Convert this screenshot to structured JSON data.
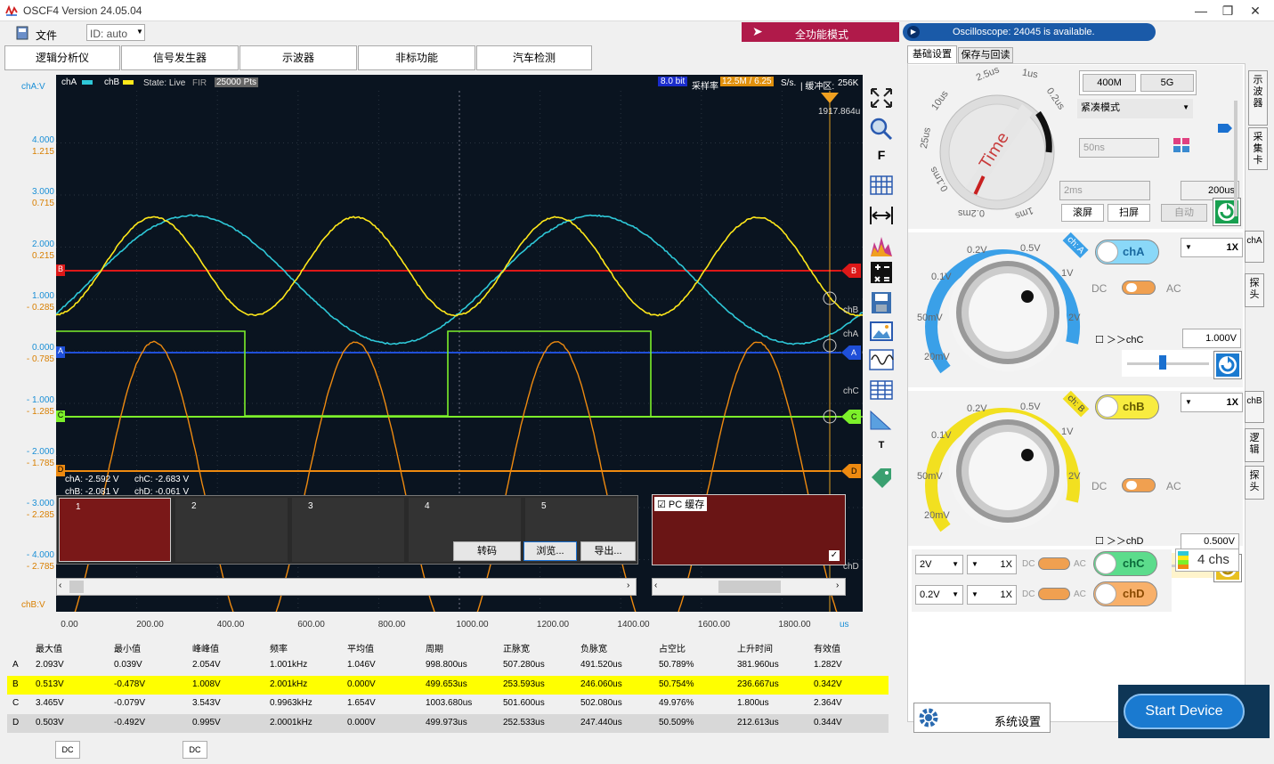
{
  "window": {
    "title": "OSCF4  Version 24.05.04",
    "min": "—",
    "max": "❐",
    "close": "✕",
    "logo_icon": "osc-logo-icon"
  },
  "menubar": {
    "file": "文件",
    "id_label": "ID: auto",
    "fullmode": "全功能模式",
    "notice": "Oscilloscope: 24045 is available."
  },
  "nav_tabs": [
    "逻辑分析仪",
    "信号发生器",
    "示波器",
    "非标功能",
    "汽车检测"
  ],
  "scope": {
    "chA_v_label": "chA:V",
    "chB_v_label": "chB:V",
    "legend": {
      "chA": "chA",
      "chB": "chB",
      "state": "State: Live",
      "fir": "FIR",
      "pts": "25000 Pts",
      "bits": "8.0 bit",
      "rate_label": "采样率",
      "rate": "12.5M / 6.25",
      "rate_unit": "S/s.",
      "buffer": "| 缓冲区:",
      "buffer_size": "256K"
    },
    "cursor_readout": "1917.864u",
    "y_blue": [
      "4.000",
      "3.000",
      "2.000",
      "1.000",
      "0.000",
      "- 1.000",
      "- 2.000",
      "- 3.000",
      "- 4.000"
    ],
    "y_orange": [
      "1.215",
      "0.715",
      "0.215",
      "- 0.285",
      "- 0.785",
      "- 1.285",
      "- 1.785",
      "- 2.285",
      "- 2.785"
    ],
    "x_ticks": [
      "0.00",
      "200.00",
      "400.00",
      "600.00",
      "800.00",
      "1000.00",
      "1200.00",
      "1400.00",
      "1600.00",
      "1800.00"
    ],
    "x_unit": "us",
    "markers": {
      "A": "A",
      "B": "B",
      "C": "C",
      "D": "D"
    },
    "right_labels": {
      "chB": "chB",
      "chA": "chA",
      "chC": "chC",
      "chD": "chD"
    },
    "probe_readout": {
      "a": "chA: -2.592 V",
      "c": "chC: -2.683 V",
      "b": "chB: -2.081 V",
      "d": "chD: -0.061 V"
    },
    "thumbs": [
      "1",
      "2",
      "3",
      "4",
      "5"
    ],
    "thumb_buttons": {
      "convert": "转码",
      "browse": "浏览...",
      "export": "导出..."
    },
    "pc_cache": "PC 缓存",
    "colors": {
      "chA": "#2ec8d8",
      "chB": "#ffe81a",
      "chC": "#7cf02a",
      "chD": "#ee8a10",
      "markB": "#dd1818",
      "markA": "#1f4fd8"
    }
  },
  "tools": [
    "fit-screen-icon",
    "zoom-icon",
    "F",
    "grid-icon",
    "measure-width-icon",
    "spectrum-icon",
    "calc-icon",
    "save-icon",
    "image-icon",
    "waveform-icon",
    "table-icon",
    "ruler-icon",
    "T",
    "tag-icon"
  ],
  "measurements": {
    "headers": [
      "最大值",
      "最小值",
      "峰峰值",
      "频率",
      "平均值",
      "周期",
      "正脉宽",
      "负脉宽",
      "占空比",
      "上升时间",
      "有效值"
    ],
    "rows": [
      {
        "ch": "A",
        "vals": [
          "2.093V",
          "0.039V",
          "2.054V",
          "1.001kHz",
          "1.046V",
          "998.800us",
          "507.280us",
          "491.520us",
          "50.789%",
          "381.960us",
          "1.282V"
        ]
      },
      {
        "ch": "B",
        "vals": [
          "0.513V",
          "-0.478V",
          "1.008V",
          "2.001kHz",
          "0.000V",
          "499.653us",
          "253.593us",
          "246.060us",
          "50.754%",
          "236.667us",
          "0.342V"
        ]
      },
      {
        "ch": "C",
        "vals": [
          "3.465V",
          "-0.079V",
          "3.543V",
          "0.9963kHz",
          "1.654V",
          "1003.680us",
          "501.600us",
          "502.080us",
          "49.976%",
          "1.800us",
          "2.364V"
        ]
      },
      {
        "ch": "D",
        "vals": [
          "0.503V",
          "-0.492V",
          "0.995V",
          "2.0001kHz",
          "0.000V",
          "499.973us",
          "252.533us",
          "247.440us",
          "50.509%",
          "212.613us",
          "0.344V"
        ]
      }
    ]
  },
  "bottom": {
    "dc1": "DC",
    "dc2": "DC"
  },
  "right": {
    "tabs": [
      "基础设置",
      "保存与回读"
    ],
    "side": {
      "scope": "示波器",
      "card": "采集卡",
      "cha": "chA",
      "probe": "探头",
      "chb": "chB",
      "logic": "逻辑",
      "probe2": "探头"
    },
    "time": {
      "sr1": "400M",
      "sr2": "5G",
      "mode": "紧凑模式",
      "tdiv": "50ns",
      "t2": "2ms",
      "t3": "200us",
      "roll": "滚屏",
      "scan": "扫屏",
      "auto": "自动",
      "knob_label": "Time",
      "dial": [
        "2.5us",
        "1us",
        "0.2us",
        "10us",
        "25us",
        "0.1ms",
        "0.2ms",
        "1ms"
      ]
    },
    "chA": {
      "name": "chA",
      "tag": "ch: A",
      "dc": "DC",
      "ac": "AC",
      "probe": "1X",
      "link": "＞＞chC",
      "vdiv": "1.000V",
      "dial": [
        "0.2V",
        "0.5V",
        "1V",
        "2V",
        "0.1V",
        "50mV",
        "20mV"
      ]
    },
    "chB": {
      "name": "chB",
      "tag": "ch: B",
      "dc": "DC",
      "ac": "AC",
      "probe": "1X",
      "link": "＞＞chD",
      "vdiv": "0.500V",
      "dial": [
        "0.2V",
        "0.5V",
        "1V",
        "2V",
        "0.1V",
        "50mV",
        "20mV"
      ]
    },
    "chC": {
      "range": "2V",
      "probe": "1X",
      "dc": "DC",
      "ac": "AC",
      "name": "chC"
    },
    "chD": {
      "range": "0.2V",
      "probe": "1X",
      "dc": "DC",
      "ac": "AC",
      "name": "chD"
    },
    "chs": "4 chs",
    "sys": "系统设置",
    "start": "Start Device"
  }
}
